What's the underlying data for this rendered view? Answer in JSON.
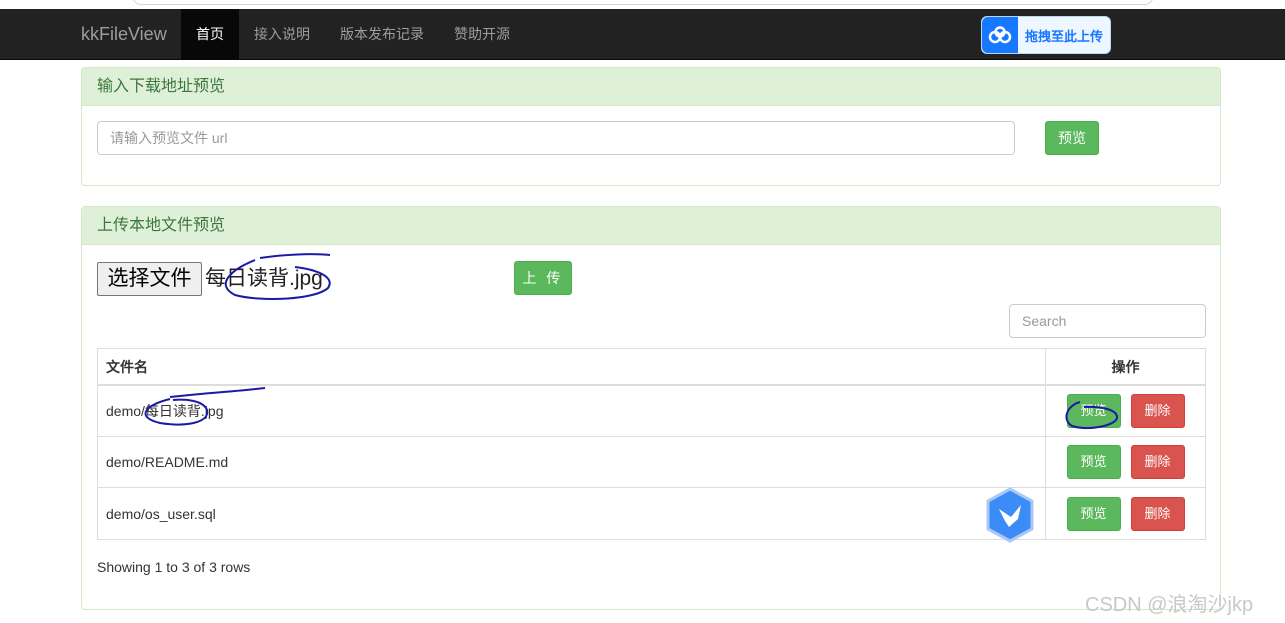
{
  "navbar": {
    "brand": "kkFileView",
    "items": [
      {
        "label": "首页",
        "active": true
      },
      {
        "label": "接入说明",
        "active": false
      },
      {
        "label": "版本发布记录",
        "active": false
      },
      {
        "label": "赞助开源",
        "active": false
      }
    ],
    "baidu_upload_label": "拖拽至此上传"
  },
  "url_panel": {
    "title": "输入下载地址预览",
    "input_placeholder": "请输入预览文件 url",
    "preview_button": "预览"
  },
  "upload_panel": {
    "title": "上传本地文件预览",
    "choose_file_button": "选择文件",
    "chosen_file": "每日读背.jpg",
    "upload_button": "上 传",
    "search_placeholder": "Search",
    "table": {
      "headers": {
        "name": "文件名",
        "ops": "操作"
      },
      "rows": [
        {
          "name": "demo/每日读背.jpg"
        },
        {
          "name": "demo/README.md"
        },
        {
          "name": "demo/os_user.sql"
        }
      ],
      "preview_label": "预览",
      "delete_label": "删除"
    },
    "pagination_text": "Showing 1 to 3 of 3 rows"
  },
  "watermark": "CSDN @浪淘沙jkp",
  "colors": {
    "navbar_bg": "#222222",
    "panel_heading_bg": "#dff0d8",
    "panel_heading_text": "#3c763d",
    "success": "#5cb85c",
    "danger": "#d9534f",
    "baidu_blue": "#1677ff"
  }
}
